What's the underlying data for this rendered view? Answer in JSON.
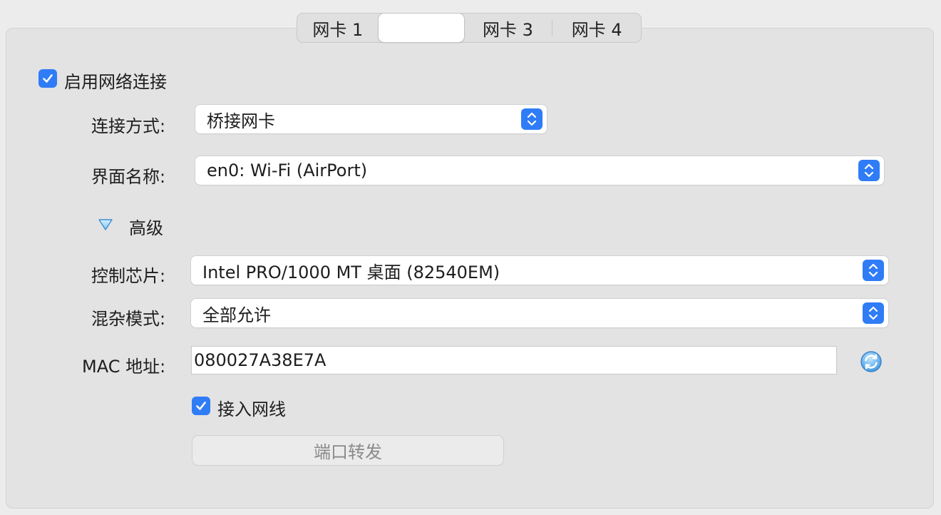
{
  "tabs": [
    {
      "label": "网卡 1"
    },
    {
      "label": ""
    },
    {
      "label": "网卡 3"
    },
    {
      "label": "网卡 4"
    }
  ],
  "enable_network": {
    "label": "启用网络连接",
    "checked": true
  },
  "attachment": {
    "label": "连接方式:",
    "value": "桥接网卡"
  },
  "interface_name": {
    "label": "界面名称:",
    "value": "en0: Wi-Fi (AirPort)"
  },
  "advanced": {
    "label": "高级",
    "expanded": true
  },
  "adapter_type": {
    "label": "控制芯片:",
    "value": "Intel PRO/1000 MT 桌面 (82540EM)"
  },
  "promiscuous": {
    "label": "混杂模式:",
    "value": "全部允许"
  },
  "mac": {
    "label": "MAC 地址:",
    "value": "080027A38E7A"
  },
  "cable_connected": {
    "label": "接入网线",
    "checked": true
  },
  "port_forwarding": {
    "label": "端口转发",
    "enabled": false
  },
  "colors": {
    "accent": "#2f7cf6",
    "panel": "#e3e3e3",
    "background": "#ececec"
  },
  "icons": {
    "checkbox": "checkmark-icon",
    "select": "up-down-chevron-icon",
    "disclosure": "disclosure-triangle-down-icon",
    "refresh": "refresh-mac-icon"
  }
}
